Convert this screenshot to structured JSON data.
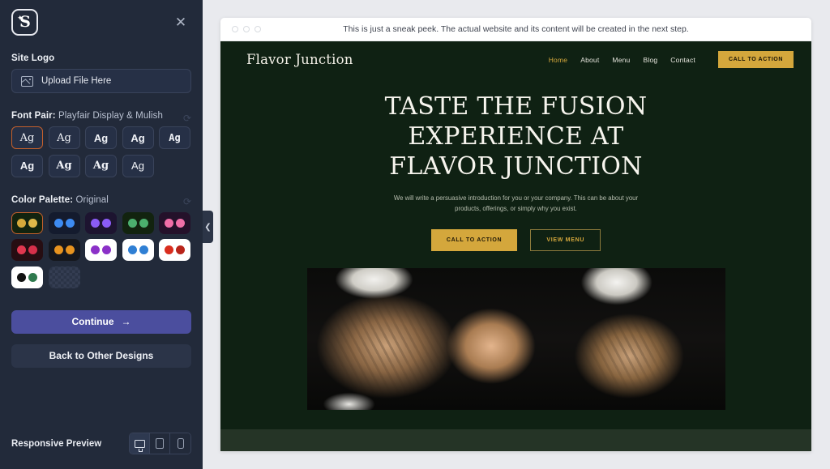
{
  "sidebar": {
    "brand_icon": "sparkle-s-logo",
    "close_icon": "close-icon",
    "site_logo": {
      "label": "Site Logo",
      "upload_text": "Upload File Here",
      "upload_icon": "image-icon"
    },
    "font_pair": {
      "label": "Font Pair:",
      "value": "Playfair Display & Mulish",
      "refresh_icon": "refresh-icon",
      "tiles": [
        {
          "sample": "Ag",
          "style": "serif",
          "selected": true
        },
        {
          "sample": "Ag",
          "style": "serif",
          "selected": false
        },
        {
          "sample": "Ag",
          "style": "sans-bold",
          "selected": false
        },
        {
          "sample": "Ag",
          "style": "sans-bold",
          "selected": false
        },
        {
          "sample": "Ag",
          "style": "mono-bold",
          "selected": false
        },
        {
          "sample": "Ag",
          "style": "sans-bold",
          "selected": false
        },
        {
          "sample": "Ag",
          "style": "serif-bold",
          "selected": false
        },
        {
          "sample": "Ag",
          "style": "serif-bold",
          "selected": false
        },
        {
          "sample": "Ag",
          "style": "sans",
          "selected": false
        }
      ]
    },
    "color_palette": {
      "label": "Color Palette:",
      "value": "Original",
      "refresh_icon": "refresh-icon",
      "swatches": [
        {
          "bg": "#12230f",
          "dots": [
            "#d6a93b",
            "#e0b84a"
          ],
          "selected": true
        },
        {
          "bg": "#141b2e",
          "dots": [
            "#3d8bf2",
            "#3d8bf2"
          ],
          "selected": false
        },
        {
          "bg": "#1d1430",
          "dots": [
            "#8b5cf6",
            "#8b5cf6"
          ],
          "selected": false
        },
        {
          "bg": "#12230f",
          "dots": [
            "#4caf6e",
            "#4caf6e"
          ],
          "selected": false
        },
        {
          "bg": "#24112a",
          "dots": [
            "#f06fa8",
            "#f06fa8"
          ],
          "selected": false
        },
        {
          "bg": "#260d12",
          "dots": [
            "#e0374f",
            "#d6304a"
          ],
          "selected": false
        },
        {
          "bg": "#15171d",
          "dots": [
            "#e8941f",
            "#e8941f"
          ],
          "selected": false
        },
        {
          "bg": "#ffffff",
          "dots": [
            "#8b31c8",
            "#8b31c8"
          ],
          "selected": false
        },
        {
          "bg": "#ffffff",
          "dots": [
            "#2f7fd4",
            "#2f7fd4"
          ],
          "selected": false
        },
        {
          "bg": "#ffffff",
          "dots": [
            "#d92d1e",
            "#b8241a"
          ],
          "selected": false
        },
        {
          "bg": "#ffffff",
          "dots": [
            "#121212",
            "#2f7a4e"
          ],
          "selected": false
        },
        {
          "bg": "checker",
          "dots": [],
          "selected": false
        }
      ]
    },
    "continue_label": "Continue",
    "continue_icon": "arrow-right-icon",
    "back_label": "Back to Other Designs",
    "responsive": {
      "label": "Responsive Preview",
      "modes": [
        {
          "icon": "desktop-icon",
          "active": true
        },
        {
          "icon": "tablet-icon",
          "active": false
        },
        {
          "icon": "mobile-icon",
          "active": false
        }
      ]
    },
    "collapse_icon": "chevron-left-icon"
  },
  "preview": {
    "banner_text": "This is just a sneak peek. The actual website and its content will be created in the next step.",
    "window_dots": 3,
    "site": {
      "brand": "Flavor Junction",
      "nav": [
        {
          "label": "Home",
          "active": true
        },
        {
          "label": "About",
          "active": false
        },
        {
          "label": "Menu",
          "active": false
        },
        {
          "label": "Blog",
          "active": false
        },
        {
          "label": "Contact",
          "active": false
        }
      ],
      "header_cta": "CALL TO ACTION",
      "hero_heading": "TASTE THE FUSION EXPERIENCE AT FLAVOR JUNCTION",
      "hero_sub": "We will write a persuasive introduction for you or your company. This can be about your products, offerings, or simply why you exist.",
      "hero_primary_cta": "CALL TO ACTION",
      "hero_secondary_cta": "VIEW MENU",
      "hero_image_alt": "chef-hands-photo",
      "accent_color": "#d4a73c",
      "background_color": "#0f2113"
    }
  }
}
